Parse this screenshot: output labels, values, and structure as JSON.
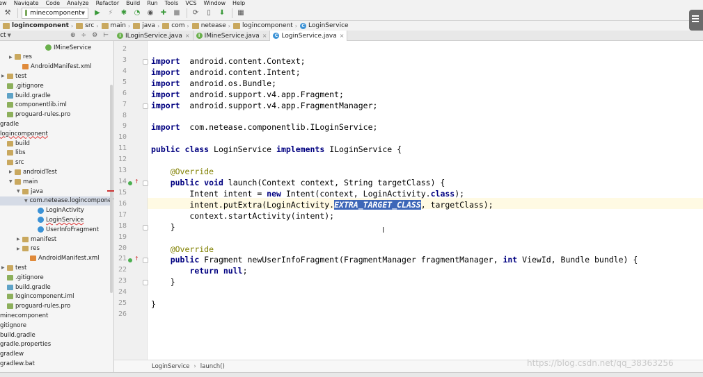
{
  "menu": [
    "iew",
    "Navigate",
    "Code",
    "Analyze",
    "Refactor",
    "Build",
    "Run",
    "Tools",
    "VCS",
    "Window",
    "Help"
  ],
  "toolbar": {
    "run_config": "minecomponent"
  },
  "breadcrumb": [
    "logincomponent",
    "src",
    "main",
    "java",
    "com",
    "netease",
    "logincomponent",
    "LoginService"
  ],
  "project_panel": {
    "label": "ct",
    "icons": [
      "⊕",
      "÷",
      "⚙",
      "⊢"
    ]
  },
  "tabs": [
    {
      "label": "ILoginService.java",
      "kind": "interface"
    },
    {
      "label": "IMineService.java",
      "kind": "interface"
    },
    {
      "label": "LoginService.java",
      "kind": "class"
    }
  ],
  "tree": [
    {
      "label": "IMineService",
      "indent": 5,
      "icon": "cls-i",
      "arrow": ""
    },
    {
      "label": "res",
      "indent": 1,
      "icon": "folder",
      "arrow": "▶"
    },
    {
      "label": "AndroidManifest.xml",
      "indent": 2,
      "icon": "xml",
      "arrow": ""
    },
    {
      "label": "test",
      "indent": 0,
      "icon": "folder",
      "arrow": "▶"
    },
    {
      "label": ".gitignore",
      "indent": 0,
      "icon": "file",
      "arrow": ""
    },
    {
      "label": "build.gradle",
      "indent": 0,
      "icon": "gradle",
      "arrow": ""
    },
    {
      "label": "componentlib.iml",
      "indent": 0,
      "icon": "file",
      "arrow": ""
    },
    {
      "label": "proguard-rules.pro",
      "indent": 0,
      "icon": "file",
      "arrow": ""
    },
    {
      "label": "gradle",
      "indent": -1,
      "icon": "",
      "arrow": ""
    },
    {
      "label": "logincomponent",
      "indent": -1,
      "icon": "",
      "arrow": ""
    },
    {
      "label": "build",
      "indent": 0,
      "icon": "folder",
      "arrow": ""
    },
    {
      "label": "libs",
      "indent": 0,
      "icon": "folder",
      "arrow": ""
    },
    {
      "label": "src",
      "indent": 0,
      "icon": "folder",
      "arrow": ""
    },
    {
      "label": "androidTest",
      "indent": 1,
      "icon": "folder",
      "arrow": "▶"
    },
    {
      "label": "main",
      "indent": 1,
      "icon": "folder",
      "arrow": "▼"
    },
    {
      "label": "java",
      "indent": 2,
      "icon": "folder",
      "arrow": "▼"
    },
    {
      "label": "com.netease.logincomponent",
      "indent": 3,
      "icon": "pkg",
      "arrow": "▼"
    },
    {
      "label": "LoginActivity",
      "indent": 4,
      "icon": "cls",
      "arrow": ""
    },
    {
      "label": "LoginService",
      "indent": 4,
      "icon": "cls",
      "arrow": ""
    },
    {
      "label": "UserInfoFragment",
      "indent": 4,
      "icon": "cls",
      "arrow": ""
    },
    {
      "label": "manifest",
      "indent": 2,
      "icon": "folder",
      "arrow": "▶"
    },
    {
      "label": "res",
      "indent": 2,
      "icon": "folder",
      "arrow": "▶"
    },
    {
      "label": "AndroidManifest.xml",
      "indent": 3,
      "icon": "xml",
      "arrow": ""
    },
    {
      "label": "test",
      "indent": 0,
      "icon": "folder",
      "arrow": "▶"
    },
    {
      "label": ".gitignore",
      "indent": 0,
      "icon": "file",
      "arrow": ""
    },
    {
      "label": "build.gradle",
      "indent": 0,
      "icon": "gradle",
      "arrow": ""
    },
    {
      "label": "logincomponent.iml",
      "indent": 0,
      "icon": "file",
      "arrow": ""
    },
    {
      "label": "proguard-rules.pro",
      "indent": 0,
      "icon": "file",
      "arrow": ""
    },
    {
      "label": "minecomponent",
      "indent": -1,
      "icon": "",
      "arrow": ""
    },
    {
      "label": "gitignore",
      "indent": -1,
      "icon": "",
      "arrow": ""
    },
    {
      "label": "build.gradle",
      "indent": -1,
      "icon": "",
      "arrow": ""
    },
    {
      "label": "gradle.properties",
      "indent": -1,
      "icon": "",
      "arrow": ""
    },
    {
      "label": "gradlew",
      "indent": -1,
      "icon": "",
      "arrow": ""
    },
    {
      "label": "gradlew.bat",
      "indent": -1,
      "icon": "",
      "arrow": ""
    }
  ],
  "line_numbers": [
    "2",
    "3",
    "4",
    "5",
    "6",
    "7",
    "8",
    "9",
    "10",
    "11",
    "12",
    "13",
    "14",
    "15",
    "16",
    "17",
    "18",
    "19",
    "20",
    "21",
    "22",
    "23",
    "24",
    "25",
    "26"
  ],
  "code_lines": [
    [],
    [
      [
        "kw",
        "import"
      ],
      [
        "",
        "  android.content.Context;"
      ]
    ],
    [
      [
        "kw",
        "import"
      ],
      [
        "",
        "  android.content.Intent;"
      ]
    ],
    [
      [
        "kw",
        "import"
      ],
      [
        "",
        "  android.os.Bundle;"
      ]
    ],
    [
      [
        "kw",
        "import"
      ],
      [
        "",
        "  android.support.v4.app.Fragment;"
      ]
    ],
    [
      [
        "kw",
        "import"
      ],
      [
        "",
        "  android.support.v4.app.FragmentManager;"
      ]
    ],
    [],
    [
      [
        "kw",
        "import"
      ],
      [
        "",
        "  com.netease.componentlib.ILoginService;"
      ]
    ],
    [],
    [
      [
        "kw",
        "public class"
      ],
      [
        "",
        " LoginService "
      ],
      [
        "kw",
        "implements"
      ],
      [
        "",
        " ILoginService {"
      ]
    ],
    [],
    [
      [
        "",
        "    "
      ],
      [
        "an",
        "@Override"
      ]
    ],
    [
      [
        "",
        "    "
      ],
      [
        "kw",
        "public void"
      ],
      [
        "",
        " launch(Context context, String targetClass) {"
      ]
    ],
    [
      [
        "",
        "        Intent intent = "
      ],
      [
        "kw",
        "new"
      ],
      [
        "",
        " Intent(context, LoginActivity."
      ],
      [
        "kw",
        "class"
      ],
      [
        "",
        ");"
      ]
    ],
    [
      [
        "",
        "        intent.putExtra(LoginActivity."
      ],
      [
        "sel-fld",
        "EXTRA_TARGET_CLASS"
      ],
      [
        "",
        ", targetClass);"
      ]
    ],
    [
      [
        "",
        "        context.startActivity(intent);"
      ]
    ],
    [
      [
        "",
        "    }"
      ]
    ],
    [],
    [
      [
        "",
        "    "
      ],
      [
        "an",
        "@Override"
      ]
    ],
    [
      [
        "",
        "    "
      ],
      [
        "kw",
        "public"
      ],
      [
        "",
        " Fragment newUserInfoFragment(FragmentManager fragmentManager, "
      ],
      [
        "kw",
        "int"
      ],
      [
        "",
        " ViewId, Bundle bundle) {"
      ]
    ],
    [
      [
        "",
        "        "
      ],
      [
        "kw",
        "return null"
      ],
      [
        "",
        ";"
      ]
    ],
    [
      [
        "",
        "    }"
      ]
    ],
    [],
    [
      [
        "",
        "}"
      ]
    ],
    []
  ],
  "status": {
    "crumb1": "LoginService",
    "crumb2": "launch()"
  },
  "watermark": "https://blog.csdn.net/qq_38363256"
}
